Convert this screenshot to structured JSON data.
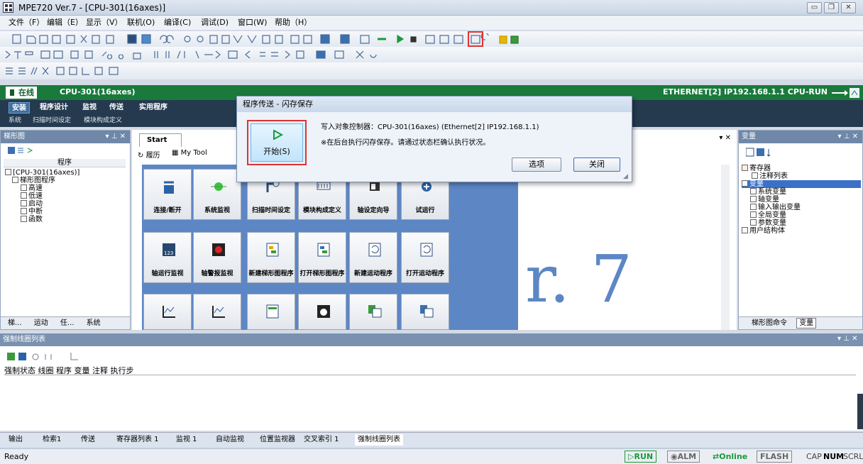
{
  "window": {
    "title": "MPE720 Ver.7 - [CPU-301(16axes)]"
  },
  "menu": [
    "文件（F）",
    "编辑（E）",
    "显示（V）",
    "联机(O)",
    "编译(C)",
    "调试(D)",
    "窗口(W)",
    "帮助（H）"
  ],
  "online": {
    "status": "在线",
    "cpu": "CPU-301(16axes)",
    "connection": "ETHERNET[2] IP192.168.1.1 CPU-RUN"
  },
  "ribbon": {
    "tabs": [
      "安装",
      "程序设计",
      "监视",
      "传送",
      "实用程序"
    ],
    "sub": [
      "系统",
      "扫描时间设定",
      "模块构成定义"
    ]
  },
  "left_panel": {
    "title": "梯形图",
    "column": "程序",
    "tree": [
      "[CPU-301(16axes)]",
      "梯形图程序",
      "高速",
      "低速",
      "启动",
      "中断",
      "函数"
    ],
    "bottom_tabs": [
      "梯...",
      "运动",
      "任...",
      "系统"
    ]
  },
  "center": {
    "tab": "Start",
    "toolbar": [
      "履历",
      "My Tool"
    ],
    "watermark": "r. 7",
    "tiles_row1": [
      "连接/断开",
      "系统监视",
      "扫描时间设定",
      "模块构成定义",
      "轴设定向导",
      "试运行"
    ],
    "tiles_row2": [
      "轴运行监视",
      "轴警报监视",
      "新建梯形图程序",
      "打开梯形图程序",
      "新建运动程序",
      "打开运动程序"
    ]
  },
  "right_panel": {
    "title": "变量",
    "tree": [
      "寄存器",
      "注释列表",
      "变量",
      "系统变量",
      "轴变量",
      "输入输出变量",
      "全局变量",
      "参数变量",
      "用户结构体"
    ],
    "bottom_tabs": [
      "梯形图命令",
      "变量"
    ]
  },
  "dialog": {
    "title": "程序传送 - 闪存保存",
    "target": "写入对象控制器：CPU-301(16axes) (Ethernet[2] IP192.168.1.1)",
    "note": "※在后台执行闪存保存。请通过状态栏确认执行状况。",
    "start": "开始(S)",
    "options": "选项",
    "close": "关闭"
  },
  "force_list": {
    "title": "强制线圈列表",
    "columns": "强制状态  线圈  程序  变量  注释  执行步"
  },
  "output_tabs": [
    "输出",
    "检索1",
    "传送",
    "寄存器列表 1",
    "监视 1",
    "自动监视",
    "位置监视器",
    "交叉索引 1",
    "强制线圈列表"
  ],
  "status": {
    "ready": "Ready",
    "run": "RUN",
    "alm": "ALM",
    "online": "Online",
    "flash": "FLASH",
    "cap": "CAP",
    "num": "NUM",
    "scrl": "SCRL"
  }
}
